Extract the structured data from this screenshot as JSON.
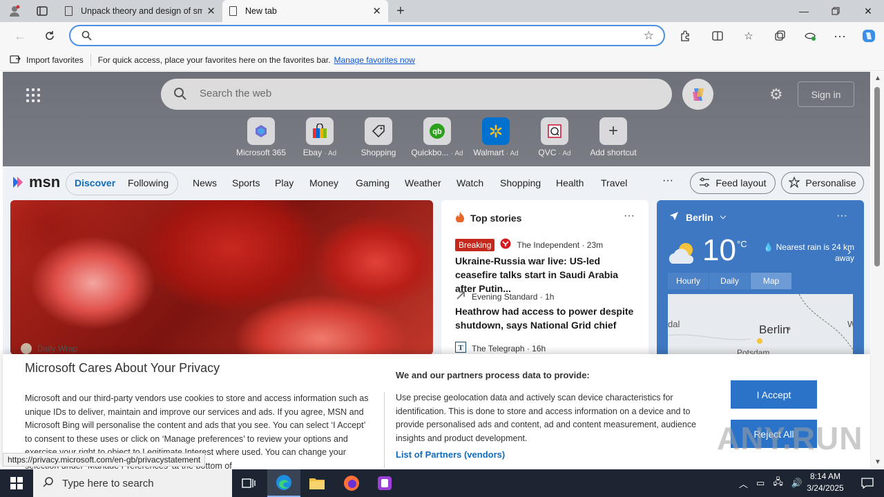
{
  "browser": {
    "tabs": [
      {
        "title": "Unpack theory and design of sm",
        "active": false
      },
      {
        "title": "New tab",
        "active": true
      }
    ],
    "new_tab_symbol": "+",
    "address_value": "",
    "favorites_bar": {
      "import_label": "Import favorites",
      "message": "For quick access, place your favorites here on the favorites bar.",
      "manage_link": "Manage favorites now"
    }
  },
  "newtab": {
    "search_placeholder": "Search the web",
    "sign_in": "Sign in",
    "shortcuts": [
      {
        "label": "Microsoft 365",
        "ad": ""
      },
      {
        "label": "Ebay",
        "ad": "· Ad"
      },
      {
        "label": "Shopping",
        "ad": ""
      },
      {
        "label": "Quickbo...",
        "ad": "· Ad"
      },
      {
        "label": "Walmart",
        "ad": "· Ad"
      },
      {
        "label": "QVC",
        "ad": "· Ad"
      },
      {
        "label": "Add shortcut",
        "ad": ""
      }
    ]
  },
  "msn": {
    "logo": "msn",
    "tabs": [
      "Discover",
      "Following"
    ],
    "nav": [
      "News",
      "Sports",
      "Play",
      "Money",
      "Gaming",
      "Weather",
      "Watch",
      "Shopping",
      "Health",
      "Travel"
    ],
    "more": "···",
    "feed_layout": "Feed layout",
    "personalise": "Personalise",
    "main_card_source": "Daily Wrap",
    "top_stories": {
      "title": "Top stories",
      "items": [
        {
          "badge": "Breaking",
          "source": "The Independent · 23m",
          "headline": "Ukraine-Russia war live: US-led ceasefire talks start in Saudi Arabia after Putin..."
        },
        {
          "badge": "",
          "source": "Evening Standard · 1h",
          "headline": "Heathrow had access to power despite shutdown, says National Grid chief"
        },
        {
          "badge": "",
          "source": "The Telegraph · 16h",
          "headline": ""
        }
      ]
    },
    "weather": {
      "city": "Berlin",
      "temp": "10",
      "unit": "°C",
      "rain": "Nearest rain is 24 km away",
      "tabs": [
        "Hourly",
        "Daily",
        "Map"
      ],
      "selected_tab": "Map",
      "map_city": "Berlin",
      "map_label_left": "dal",
      "map_label_right": "W",
      "map_label_bottom": "Potsdam"
    }
  },
  "privacy": {
    "title": "Microsoft Cares About Your Privacy",
    "body": "Microsoft and our third-party vendors use cookies to store and access information such as unique IDs to deliver, maintain and improve our services and ads. If you agree, MSN and Microsoft Bing will personalise the content and ads that you see. You can select ‘I Accept’ to consent to these uses or click on ‘Manage preferences’ to review your options and exercise your right to object to Legitimate Interest where used. You can change your selection under ‘Manage Preferences’ at the bottom of",
    "purpose_title": "We and our partners process data to provide:",
    "purpose_body": "Use precise geolocation data and actively scan device characteristics for identification. This is done to store and access information on a device and to provide personalised ads and content, ad and content measurement, audience insights and product development.",
    "partners_link": "List of Partners (vendors)",
    "accept": "I Accept",
    "reject": "Reject All",
    "watermark": "ANY.RUN"
  },
  "status_url": "https://privacy.microsoft.com/en-gb/privacystatement",
  "taskbar": {
    "search_placeholder": "Type here to search",
    "time": "8:14 AM",
    "date": "3/24/2025"
  }
}
